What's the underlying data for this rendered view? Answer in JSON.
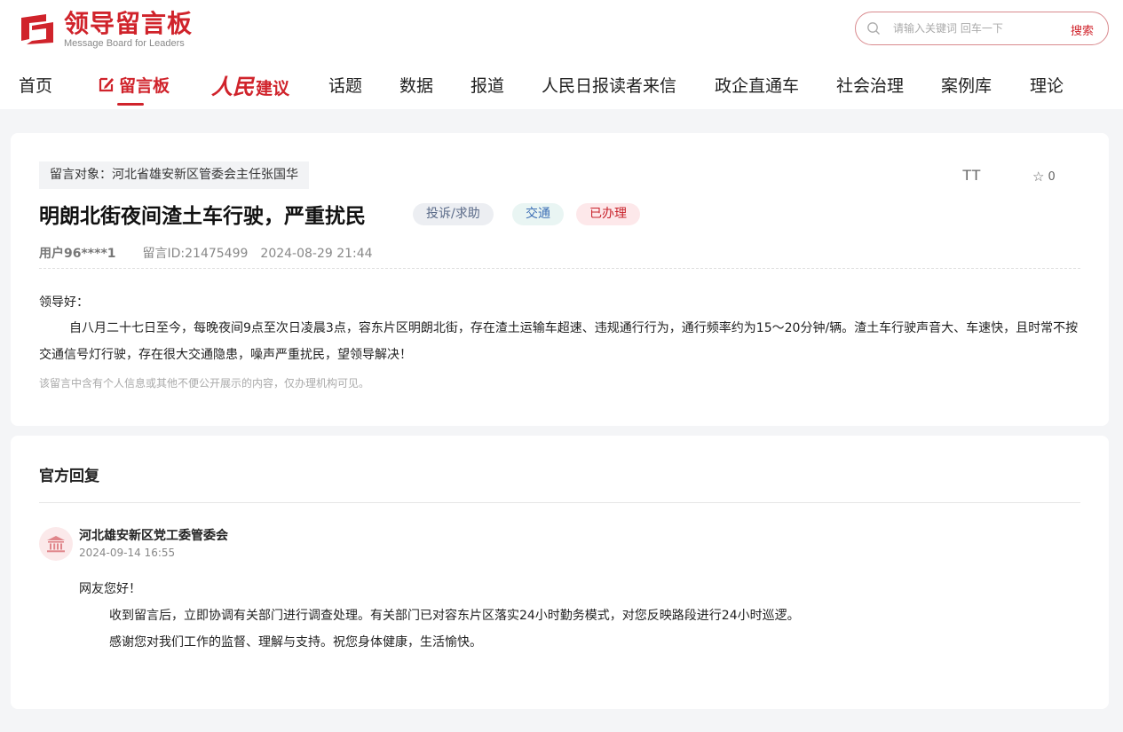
{
  "brand": {
    "title": "领导留言板",
    "subtitle": "Message Board for Leaders",
    "accent_color": "#d0232b"
  },
  "search": {
    "placeholder": "请输入关键词 回车一下",
    "button_label": "搜索",
    "icon": "search-icon"
  },
  "nav": {
    "items": [
      {
        "label": "首页"
      },
      {
        "label": "留言板",
        "active": true,
        "icon": "edit-icon"
      },
      {
        "label_script": "人民",
        "label": "建议"
      },
      {
        "label": "话题"
      },
      {
        "label": "数据"
      },
      {
        "label": "报道"
      },
      {
        "label": "人民日报读者来信"
      },
      {
        "label": "政企直通车"
      },
      {
        "label": "社会治理"
      },
      {
        "label": "案例库"
      },
      {
        "label": "理论"
      }
    ]
  },
  "message": {
    "target": "留言对象：河北省雄安新区管委会主任张国华",
    "title": "明朗北街夜间渣土车行驶，严重扰民",
    "badges": {
      "type": "投诉/求助",
      "field": "交通",
      "status": "已办理"
    },
    "favorite_count": "0",
    "font_size_toggle": "TT",
    "user": "用户96****1",
    "message_id": "留言ID:21475499",
    "datetime": "2024-08-29 21:44",
    "greeting": "领导好：",
    "body": "自八月二十七日至今，每晚夜间9点至次日凌晨3点，容东片区明朗北街，存在渣土运输车超速、违规通行行为，通行频率约为15～20分钟/辆。渣土车行驶声音大、车速快，且时常不按交通信号灯行驶，存在很大交通隐患，噪声严重扰民，望领导解决！",
    "privacy_note": "该留言中含有个人信息或其他不便公开展示的内容，仅办理机构可见。"
  },
  "reply": {
    "heading": "官方回复",
    "department": "河北雄安新区党工委管委会",
    "datetime": "2024-09-14 16:55",
    "greeting": "网友您好！",
    "paragraph1": "收到留言后，立即协调有关部门进行调查处理。有关部门已对容东片区落实24小时勤务模式，对您反映路段进行24小时巡逻。",
    "paragraph2": "感谢您对我们工作的监督、理解与支持。祝您身体健康，生活愉快。"
  }
}
